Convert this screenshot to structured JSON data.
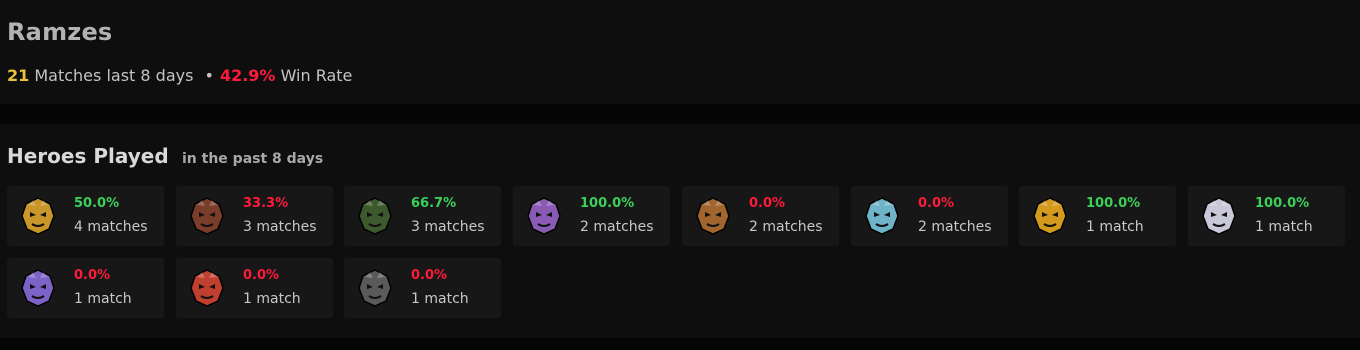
{
  "player": {
    "name": "Ramzes",
    "match_count": "21",
    "matches_text": "Matches last 8 days",
    "separator": "•",
    "win_rate": "42.9%",
    "win_rate_text": "Win Rate"
  },
  "heroes": {
    "title": "Heroes Played",
    "subtitle": "in the past 8 days",
    "cards": [
      {
        "win_rate": "50.0%",
        "matches": "4 matches",
        "icon": "hero-portrait-gold-spiky-icon",
        "tone": "good",
        "color": "#c9962a"
      },
      {
        "win_rate": "33.3%",
        "matches": "3 matches",
        "icon": "hero-portrait-bear-icon",
        "tone": "bad",
        "color": "#7a3d2a"
      },
      {
        "win_rate": "66.7%",
        "matches": "3 matches",
        "icon": "hero-portrait-green-horned-icon",
        "tone": "good",
        "color": "#3c5a2e"
      },
      {
        "win_rate": "100.0%",
        "matches": "2 matches",
        "icon": "hero-portrait-purple-crown-icon",
        "tone": "good",
        "color": "#8a5bb4"
      },
      {
        "win_rate": "0.0%",
        "matches": "2 matches",
        "icon": "hero-portrait-goggles-icon",
        "tone": "bad",
        "color": "#a0662e"
      },
      {
        "win_rate": "0.0%",
        "matches": "2 matches",
        "icon": "hero-portrait-ice-blue-icon",
        "tone": "bad",
        "color": "#6fb3c9"
      },
      {
        "win_rate": "100.0%",
        "matches": "1 match",
        "icon": "hero-portrait-orange-brute-icon",
        "tone": "good",
        "color": "#d39a1e"
      },
      {
        "win_rate": "100.0%",
        "matches": "1 match",
        "icon": "hero-portrait-silver-mask-icon",
        "tone": "good",
        "color": "#c8c8d8"
      },
      {
        "win_rate": "0.0%",
        "matches": "1 match",
        "icon": "hero-portrait-purple-horned-icon",
        "tone": "bad",
        "color": "#7b63c8"
      },
      {
        "win_rate": "0.0%",
        "matches": "1 match",
        "icon": "hero-portrait-red-monkey-icon",
        "tone": "bad",
        "color": "#c0402f"
      },
      {
        "win_rate": "0.0%",
        "matches": "1 match",
        "icon": "hero-portrait-dark-armored-icon",
        "tone": "bad",
        "color": "#5a5a5a"
      }
    ]
  }
}
